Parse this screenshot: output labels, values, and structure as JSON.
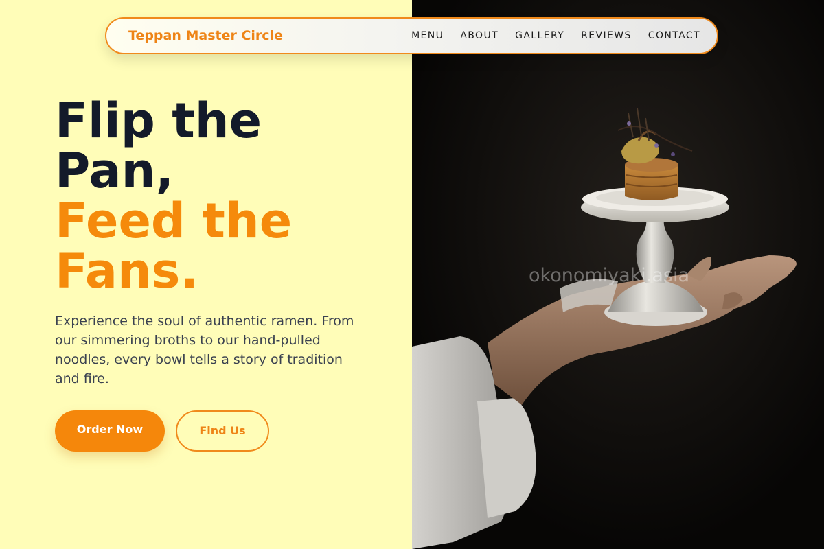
{
  "header": {
    "brand": "Teppan Master Circle",
    "nav": [
      "MENU",
      "ABOUT",
      "GALLERY",
      "REVIEWS",
      "CONTACT"
    ]
  },
  "hero": {
    "title_line1": "Flip the",
    "title_line2": "Pan,",
    "title_line3": "Feed the",
    "title_line4": "Fans.",
    "description": "Experience the soul of authentic ramen. From our simmering broths to our hand-pulled noodles, every bowl tells a story of tradition and fire.",
    "primary_button": "Order Now",
    "secondary_button": "Find Us"
  },
  "image": {
    "watermark": "okonomiyaki.asia"
  },
  "colors": {
    "background": "#fffdb8",
    "accent": "#f5870b",
    "title_dark": "#131a2a",
    "body_text": "#3a4150"
  }
}
